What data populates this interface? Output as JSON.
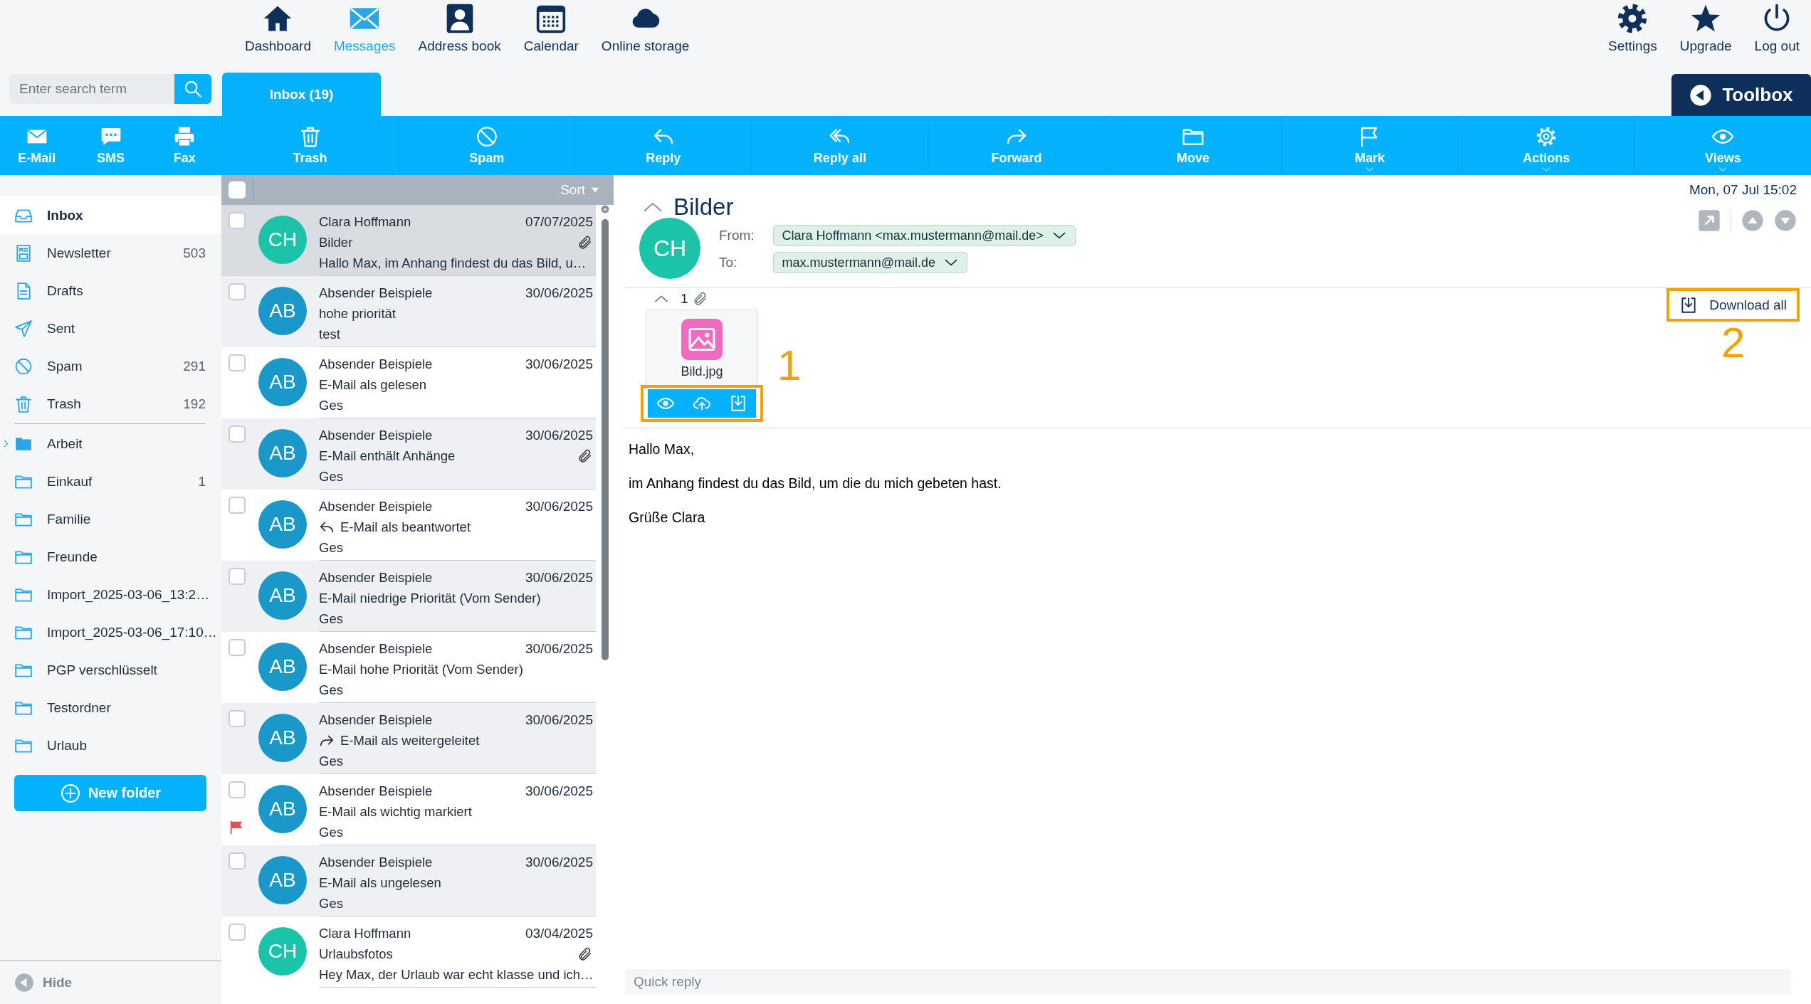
{
  "top_nav": {
    "items": [
      {
        "label": "Dashboard",
        "selected": false
      },
      {
        "label": "Messages",
        "selected": true
      },
      {
        "label": "Address book",
        "selected": false
      },
      {
        "label": "Calendar",
        "selected": false
      },
      {
        "label": "Online storage",
        "selected": false
      }
    ],
    "right": [
      {
        "label": "Settings"
      },
      {
        "label": "Upgrade"
      },
      {
        "label": "Log out"
      }
    ]
  },
  "search": {
    "placeholder": "Enter search term"
  },
  "folder_tab": {
    "label": "Inbox (19)"
  },
  "toolbox": {
    "label": "Toolbox"
  },
  "compose": [
    {
      "label": "E-Mail"
    },
    {
      "label": "SMS"
    },
    {
      "label": "Fax"
    }
  ],
  "toolbar": [
    {
      "label": "Trash",
      "dropdown": false
    },
    {
      "label": "Spam",
      "dropdown": false
    },
    {
      "label": "Reply",
      "dropdown": false
    },
    {
      "label": "Reply all",
      "dropdown": false
    },
    {
      "label": "Forward",
      "dropdown": false
    },
    {
      "label": "Move",
      "dropdown": false
    },
    {
      "label": "Mark",
      "dropdown": true
    },
    {
      "label": "Actions",
      "dropdown": true
    },
    {
      "label": "Views",
      "dropdown": true
    }
  ],
  "system_folders": [
    {
      "label": "Inbox",
      "selected": true
    },
    {
      "label": "Newsletter",
      "count": "503",
      "selected": false
    },
    {
      "label": "Drafts",
      "selected": false
    },
    {
      "label": "Sent",
      "selected": false
    },
    {
      "label": "Spam",
      "count": "291",
      "selected": false
    },
    {
      "label": "Trash",
      "count": "192",
      "selected": false
    }
  ],
  "user_folders": [
    {
      "label": "Arbeit",
      "has_subfolders": true,
      "selected": false
    },
    {
      "label": "Einkauf",
      "count": "1",
      "has_subfolders": false,
      "selected": false
    },
    {
      "label": "Familie",
      "has_subfolders": false,
      "selected": false
    },
    {
      "label": "Freunde",
      "has_subfolders": false,
      "selected": false
    },
    {
      "label": "Import_2025-03-06_13:2…",
      "has_subfolders": false,
      "selected": false
    },
    {
      "label": "Import_2025-03-06_17:10…",
      "has_subfolders": false,
      "selected": false
    },
    {
      "label": "PGP verschlüsselt",
      "has_subfolders": false,
      "selected": false
    },
    {
      "label": "Testordner",
      "has_subfolders": false,
      "selected": false
    },
    {
      "label": "Urlaub",
      "has_subfolders": false,
      "selected": false
    }
  ],
  "new_folder_button": "New folder",
  "hide_button": "Hide",
  "message_list": {
    "select_all_checked": false,
    "sort_label": "Sort",
    "messages": [
      {
        "initials": "CH",
        "color": "#1bc4a8",
        "sender": "Clara Hoffmann",
        "date": "07/07/2025",
        "subject": "Bilder",
        "preview": "Hallo Max, im Anhang findest du das Bild, u…",
        "attachment": true,
        "flagged": false,
        "replied": false,
        "forwarded": false,
        "checked": false,
        "selected": true
      },
      {
        "initials": "AB",
        "color": "#1a98c9",
        "sender": "Absender Beispiele",
        "date": "30/06/2025",
        "subject": "hohe priorität",
        "preview": "test",
        "attachment": false,
        "flagged": false,
        "replied": false,
        "forwarded": false,
        "checked": false,
        "selected": false
      },
      {
        "initials": "AB",
        "color": "#1a98c9",
        "sender": "Absender Beispiele",
        "date": "30/06/2025",
        "subject": "E-Mail als gelesen",
        "preview": "Ges",
        "attachment": false,
        "flagged": false,
        "replied": false,
        "forwarded": false,
        "checked": false,
        "selected": false
      },
      {
        "initials": "AB",
        "color": "#1a98c9",
        "sender": "Absender Beispiele",
        "date": "30/06/2025",
        "subject": "E-Mail enthält Anhänge",
        "preview": "Ges",
        "attachment": true,
        "flagged": false,
        "replied": false,
        "forwarded": false,
        "checked": false,
        "selected": false
      },
      {
        "initials": "AB",
        "color": "#1a98c9",
        "sender": "Absender Beispiele",
        "date": "30/06/2025",
        "subject": "E-Mail als beantwortet",
        "preview": "Ges",
        "attachment": false,
        "flagged": false,
        "replied": true,
        "forwarded": false,
        "checked": false,
        "selected": false
      },
      {
        "initials": "AB",
        "color": "#1a98c9",
        "sender": "Absender Beispiele",
        "date": "30/06/2025",
        "subject": "E-Mail niedrige Priorität (Vom Sender)",
        "preview": "Ges",
        "attachment": false,
        "flagged": false,
        "replied": false,
        "forwarded": false,
        "checked": false,
        "selected": false
      },
      {
        "initials": "AB",
        "color": "#1a98c9",
        "sender": "Absender Beispiele",
        "date": "30/06/2025",
        "subject": "E-Mail hohe Priorität (Vom Sender)",
        "preview": "Ges",
        "attachment": false,
        "flagged": false,
        "replied": false,
        "forwarded": false,
        "checked": false,
        "selected": false
      },
      {
        "initials": "AB",
        "color": "#1a98c9",
        "sender": "Absender Beispiele",
        "date": "30/06/2025",
        "subject": "E-Mail als weitergeleitet",
        "preview": "Ges",
        "attachment": false,
        "flagged": false,
        "replied": false,
        "forwarded": true,
        "checked": false,
        "selected": false
      },
      {
        "initials": "AB",
        "color": "#1a98c9",
        "sender": "Absender Beispiele",
        "date": "30/06/2025",
        "subject": "E-Mail als wichtig markiert",
        "preview": "Ges",
        "attachment": false,
        "flagged": true,
        "replied": false,
        "forwarded": false,
        "checked": false,
        "selected": false
      },
      {
        "initials": "AB",
        "color": "#1a98c9",
        "sender": "Absender Beispiele",
        "date": "30/06/2025",
        "subject": "E-Mail als ungelesen",
        "preview": "Ges",
        "attachment": false,
        "flagged": false,
        "replied": false,
        "forwarded": false,
        "checked": false,
        "selected": false
      },
      {
        "initials": "CH",
        "color": "#1bc4a8",
        "sender": "Clara Hoffmann",
        "date": "03/04/2025",
        "subject": "Urlaubsfotos",
        "preview": "Hey Max, der Urlaub war echt klasse und ich…",
        "attachment": true,
        "flagged": false,
        "replied": false,
        "forwarded": false,
        "checked": false,
        "selected": false
      }
    ]
  },
  "message": {
    "subject": "Bilder",
    "date": "Mon, 07 Jul 15:02",
    "initials": "CH",
    "color": "#1bc4a8",
    "from_label": "From:",
    "from": "Clara Hoffmann <max.mustermann@mail.de>",
    "to_label": "To:",
    "to": "max.mustermann@mail.de",
    "attachment_count": "1",
    "attachments": [
      {
        "name": "Bild.jpg",
        "callout": "1"
      }
    ],
    "download_all": {
      "label": "Download all",
      "callout": "2"
    },
    "body": [
      "Hallo Max,",
      "im Anhang findest du das Bild, um die du mich gebeten hast.",
      "Grüße Clara"
    ]
  },
  "quick_reply": {
    "placeholder": "Quick reply"
  }
}
